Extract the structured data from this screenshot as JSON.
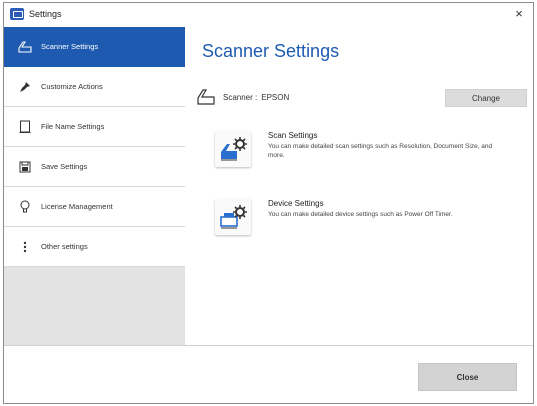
{
  "window": {
    "title": "Settings",
    "close_symbol": "×"
  },
  "sidebar": {
    "items": [
      {
        "label": "Scanner Settings",
        "icon": "scanner-icon",
        "active": true
      },
      {
        "label": "Customize Actions",
        "icon": "pin-icon",
        "active": false
      },
      {
        "label": "File Name Settings",
        "icon": "document-icon",
        "active": false
      },
      {
        "label": "Save Settings",
        "icon": "save-icon",
        "active": false
      },
      {
        "label": "License Management",
        "icon": "lightbulb-icon",
        "active": false
      },
      {
        "label": "Other settings",
        "icon": "more-vertical-icon",
        "active": false
      }
    ]
  },
  "main": {
    "title": "Scanner Settings",
    "scanner_label": "Scanner :",
    "scanner_value": "EPSON",
    "change_label": "Change",
    "options": [
      {
        "title": "Scan Settings",
        "description": "You can make detailed scan settings such as Resolution, Document Size, and more.",
        "icon": "scan-settings-icon"
      },
      {
        "title": "Device Settings",
        "description": "You can make detailed device settings such as Power Off Timer.",
        "icon": "device-settings-icon"
      }
    ]
  },
  "footer": {
    "close_label": "Close"
  },
  "colors": {
    "accent": "#1f5ab1",
    "sidebar_bg": "#e3e3e3",
    "button_bg": "#d3d3d3"
  }
}
